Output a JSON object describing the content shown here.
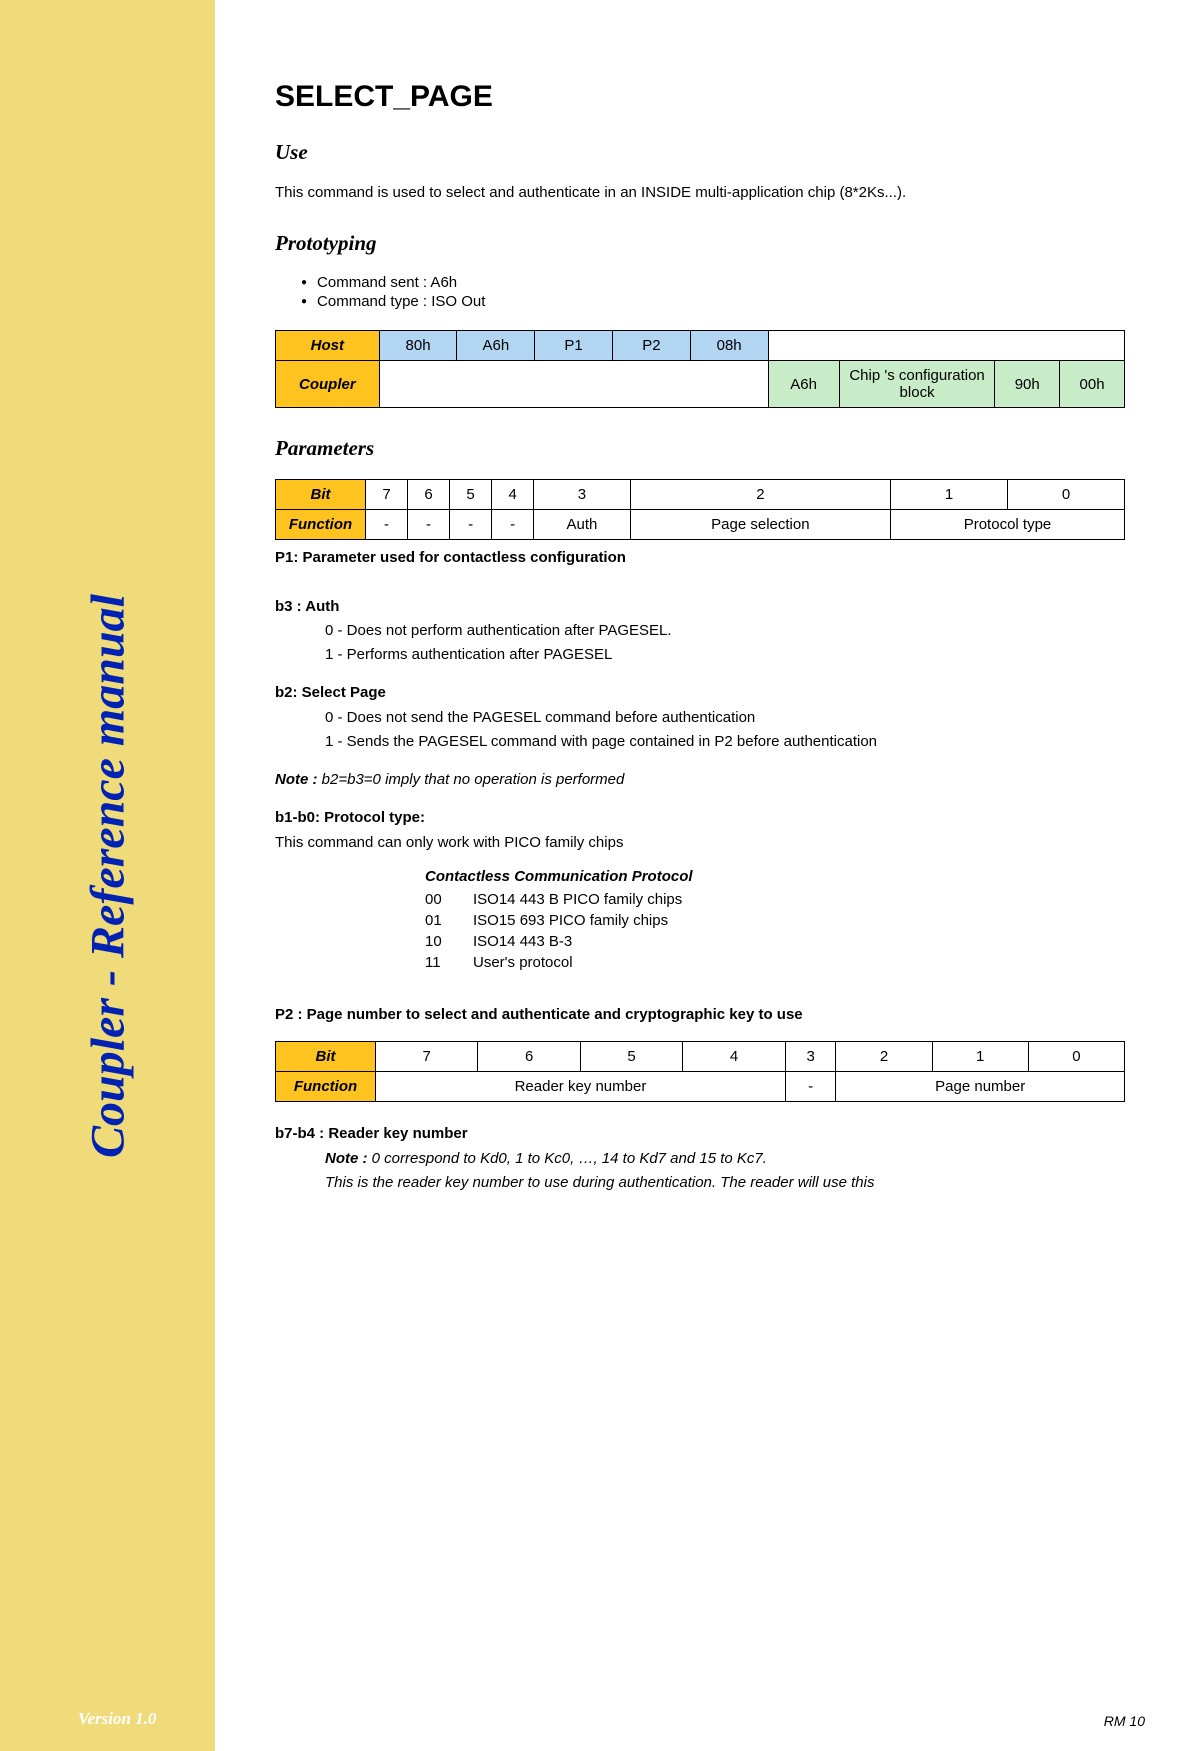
{
  "sidebar": {
    "title": "Coupler - Reference manual",
    "version": "Version 1.0"
  },
  "main": {
    "title": "SELECT_PAGE",
    "use_heading": "Use",
    "use_text": "This command is used to select and authenticate in an INSIDE multi-application chip (8*2Ks...).",
    "proto_heading": "Prototyping",
    "proto_bullets": [
      "Command sent : A6h",
      "Command type : ISO Out"
    ],
    "cmd_table": {
      "host_label": "Host",
      "host_cells": [
        "80h",
        "A6h",
        "P1",
        "P2",
        "08h"
      ],
      "coupler_label": "Coupler",
      "coupler_cells": [
        "A6h",
        "Chip 's configuration block",
        "90h",
        "00h"
      ]
    },
    "params_heading": "Parameters",
    "p1_table": {
      "bit_label": "Bit",
      "bits": [
        "7",
        "6",
        "5",
        "4",
        "3",
        "2",
        "1",
        "0"
      ],
      "func_label": "Function",
      "funcs": [
        "-",
        "-",
        "-",
        "-",
        "Auth",
        "Page selection",
        "Protocol type"
      ]
    },
    "p1_caption": "P1: Parameter used for contactless configuration",
    "b3_title": "b3 : Auth",
    "b3_lines": [
      "0 - Does not perform authentication after PAGESEL.",
      "1 - Performs authentication after PAGESEL"
    ],
    "b2_title": "b2: Select Page",
    "b2_lines": [
      "0 - Does not send the PAGESEL command before authentication",
      "1 - Sends the PAGESEL command with page contained in P2 before authentication"
    ],
    "note_label": "Note :",
    "note_text": " b2=b3=0 imply that no operation is performed",
    "b1b0_title": "b1-b0: Protocol type:",
    "b1b0_text": "This command can only work with PICO family chips",
    "proto_table_title": "Contactless Communication Protocol",
    "proto_rows": [
      {
        "code": "00",
        "label": "ISO14 443 B PICO family chips"
      },
      {
        "code": "01",
        "label": "ISO15 693 PICO family chips"
      },
      {
        "code": "10",
        "label": "ISO14 443 B-3"
      },
      {
        "code": "11",
        "label": "User's protocol"
      }
    ],
    "p2_caption": "P2 : Page number to select and authenticate and cryptographic key to use",
    "p2_table": {
      "bit_label": "Bit",
      "bits": [
        "7",
        "6",
        "5",
        "4",
        "3",
        "2",
        "1",
        "0"
      ],
      "func_label": "Function",
      "funcs": [
        "Reader key number",
        "-",
        "Page number"
      ]
    },
    "b7b4_prefix": "b7-b4",
    "b7b4_title": " : Reader key number",
    "b7b4_note_label": "Note :",
    "b7b4_note": " 0 correspond to Kd0, 1 to Kc0, …, 14 to Kd7 and 15 to Kc7.",
    "b7b4_note2": "This is the reader key number to use during authentication. The reader will use this"
  },
  "page_number": "RM 10"
}
